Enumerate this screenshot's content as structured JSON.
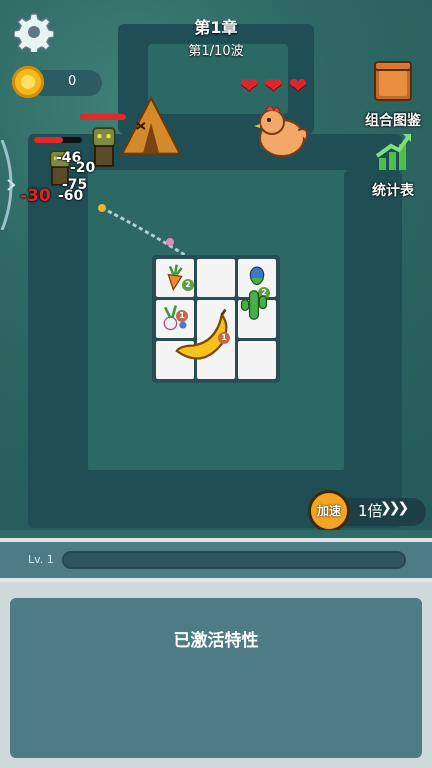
{
  "header": {
    "chapter": "第1章",
    "wave": "第1/10波"
  },
  "coins": {
    "value": "0"
  },
  "sidebar": {
    "collection_label": "组合图鉴",
    "stats_label": "统计表"
  },
  "player": {
    "hearts": "❤❤❤"
  },
  "damage_numbers": [
    "-46",
    "-20",
    "-75",
    "-60",
    "-30"
  ],
  "speed": {
    "label": "加速",
    "value": "1倍"
  },
  "level": {
    "label": "Lv. 1",
    "progress": 0
  },
  "traits": {
    "title": "已激活特性"
  },
  "colors": {
    "accent": "#f3a420",
    "heart": "#e0242b",
    "panel": "#4d7b86"
  }
}
